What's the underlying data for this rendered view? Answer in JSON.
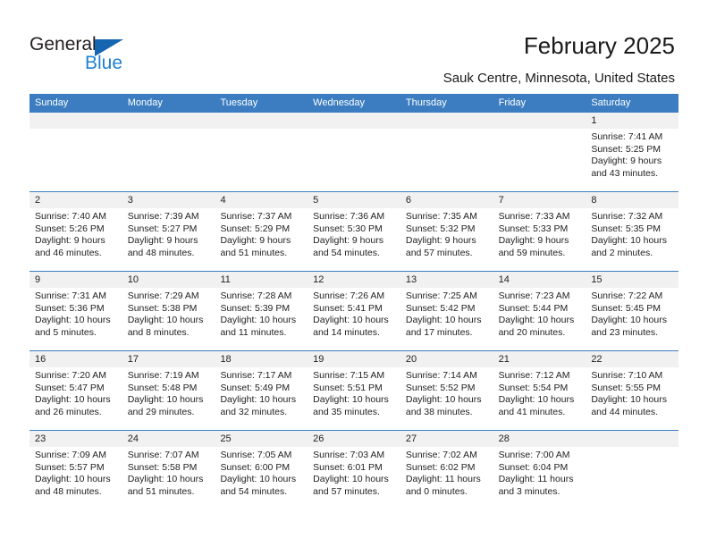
{
  "brand": {
    "name_top": "General",
    "name_bottom": "Blue",
    "color_top": "#231f20",
    "color_bottom": "#2081d0",
    "triangle_color": "#1565b0"
  },
  "header": {
    "title": "February 2025",
    "subtitle": "Sauk Centre, Minnesota, United States"
  },
  "theme": {
    "header_blue": "#3b7dc0",
    "daynum_band": "#f1f1f1",
    "text": "#222222"
  },
  "weekdays": [
    "Sunday",
    "Monday",
    "Tuesday",
    "Wednesday",
    "Thursday",
    "Friday",
    "Saturday"
  ],
  "weeks": [
    [
      {
        "day": "",
        "sunrise": "",
        "sunset": "",
        "daylight": ""
      },
      {
        "day": "",
        "sunrise": "",
        "sunset": "",
        "daylight": ""
      },
      {
        "day": "",
        "sunrise": "",
        "sunset": "",
        "daylight": ""
      },
      {
        "day": "",
        "sunrise": "",
        "sunset": "",
        "daylight": ""
      },
      {
        "day": "",
        "sunrise": "",
        "sunset": "",
        "daylight": ""
      },
      {
        "day": "",
        "sunrise": "",
        "sunset": "",
        "daylight": ""
      },
      {
        "day": "1",
        "sunrise": "Sunrise: 7:41 AM",
        "sunset": "Sunset: 5:25 PM",
        "daylight": "Daylight: 9 hours and 43 minutes."
      }
    ],
    [
      {
        "day": "2",
        "sunrise": "Sunrise: 7:40 AM",
        "sunset": "Sunset: 5:26 PM",
        "daylight": "Daylight: 9 hours and 46 minutes."
      },
      {
        "day": "3",
        "sunrise": "Sunrise: 7:39 AM",
        "sunset": "Sunset: 5:27 PM",
        "daylight": "Daylight: 9 hours and 48 minutes."
      },
      {
        "day": "4",
        "sunrise": "Sunrise: 7:37 AM",
        "sunset": "Sunset: 5:29 PM",
        "daylight": "Daylight: 9 hours and 51 minutes."
      },
      {
        "day": "5",
        "sunrise": "Sunrise: 7:36 AM",
        "sunset": "Sunset: 5:30 PM",
        "daylight": "Daylight: 9 hours and 54 minutes."
      },
      {
        "day": "6",
        "sunrise": "Sunrise: 7:35 AM",
        "sunset": "Sunset: 5:32 PM",
        "daylight": "Daylight: 9 hours and 57 minutes."
      },
      {
        "day": "7",
        "sunrise": "Sunrise: 7:33 AM",
        "sunset": "Sunset: 5:33 PM",
        "daylight": "Daylight: 9 hours and 59 minutes."
      },
      {
        "day": "8",
        "sunrise": "Sunrise: 7:32 AM",
        "sunset": "Sunset: 5:35 PM",
        "daylight": "Daylight: 10 hours and 2 minutes."
      }
    ],
    [
      {
        "day": "9",
        "sunrise": "Sunrise: 7:31 AM",
        "sunset": "Sunset: 5:36 PM",
        "daylight": "Daylight: 10 hours and 5 minutes."
      },
      {
        "day": "10",
        "sunrise": "Sunrise: 7:29 AM",
        "sunset": "Sunset: 5:38 PM",
        "daylight": "Daylight: 10 hours and 8 minutes."
      },
      {
        "day": "11",
        "sunrise": "Sunrise: 7:28 AM",
        "sunset": "Sunset: 5:39 PM",
        "daylight": "Daylight: 10 hours and 11 minutes."
      },
      {
        "day": "12",
        "sunrise": "Sunrise: 7:26 AM",
        "sunset": "Sunset: 5:41 PM",
        "daylight": "Daylight: 10 hours and 14 minutes."
      },
      {
        "day": "13",
        "sunrise": "Sunrise: 7:25 AM",
        "sunset": "Sunset: 5:42 PM",
        "daylight": "Daylight: 10 hours and 17 minutes."
      },
      {
        "day": "14",
        "sunrise": "Sunrise: 7:23 AM",
        "sunset": "Sunset: 5:44 PM",
        "daylight": "Daylight: 10 hours and 20 minutes."
      },
      {
        "day": "15",
        "sunrise": "Sunrise: 7:22 AM",
        "sunset": "Sunset: 5:45 PM",
        "daylight": "Daylight: 10 hours and 23 minutes."
      }
    ],
    [
      {
        "day": "16",
        "sunrise": "Sunrise: 7:20 AM",
        "sunset": "Sunset: 5:47 PM",
        "daylight": "Daylight: 10 hours and 26 minutes."
      },
      {
        "day": "17",
        "sunrise": "Sunrise: 7:19 AM",
        "sunset": "Sunset: 5:48 PM",
        "daylight": "Daylight: 10 hours and 29 minutes."
      },
      {
        "day": "18",
        "sunrise": "Sunrise: 7:17 AM",
        "sunset": "Sunset: 5:49 PM",
        "daylight": "Daylight: 10 hours and 32 minutes."
      },
      {
        "day": "19",
        "sunrise": "Sunrise: 7:15 AM",
        "sunset": "Sunset: 5:51 PM",
        "daylight": "Daylight: 10 hours and 35 minutes."
      },
      {
        "day": "20",
        "sunrise": "Sunrise: 7:14 AM",
        "sunset": "Sunset: 5:52 PM",
        "daylight": "Daylight: 10 hours and 38 minutes."
      },
      {
        "day": "21",
        "sunrise": "Sunrise: 7:12 AM",
        "sunset": "Sunset: 5:54 PM",
        "daylight": "Daylight: 10 hours and 41 minutes."
      },
      {
        "day": "22",
        "sunrise": "Sunrise: 7:10 AM",
        "sunset": "Sunset: 5:55 PM",
        "daylight": "Daylight: 10 hours and 44 minutes."
      }
    ],
    [
      {
        "day": "23",
        "sunrise": "Sunrise: 7:09 AM",
        "sunset": "Sunset: 5:57 PM",
        "daylight": "Daylight: 10 hours and 48 minutes."
      },
      {
        "day": "24",
        "sunrise": "Sunrise: 7:07 AM",
        "sunset": "Sunset: 5:58 PM",
        "daylight": "Daylight: 10 hours and 51 minutes."
      },
      {
        "day": "25",
        "sunrise": "Sunrise: 7:05 AM",
        "sunset": "Sunset: 6:00 PM",
        "daylight": "Daylight: 10 hours and 54 minutes."
      },
      {
        "day": "26",
        "sunrise": "Sunrise: 7:03 AM",
        "sunset": "Sunset: 6:01 PM",
        "daylight": "Daylight: 10 hours and 57 minutes."
      },
      {
        "day": "27",
        "sunrise": "Sunrise: 7:02 AM",
        "sunset": "Sunset: 6:02 PM",
        "daylight": "Daylight: 11 hours and 0 minutes."
      },
      {
        "day": "28",
        "sunrise": "Sunrise: 7:00 AM",
        "sunset": "Sunset: 6:04 PM",
        "daylight": "Daylight: 11 hours and 3 minutes."
      },
      {
        "day": "",
        "sunrise": "",
        "sunset": "",
        "daylight": ""
      }
    ]
  ]
}
